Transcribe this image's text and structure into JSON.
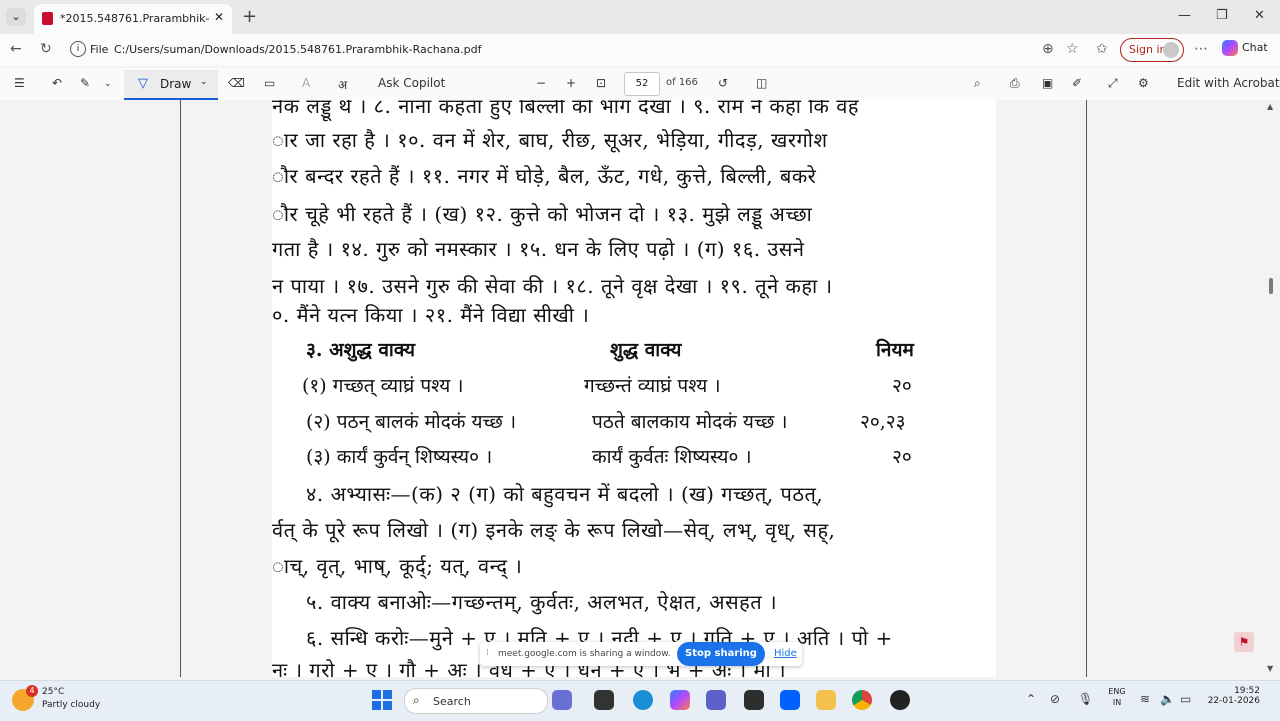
{
  "browser": {
    "tab_title": "*2015.548761.Prarambhik-Rachana.pdf",
    "tab_close": "✕",
    "new_tab": "+",
    "file_label": "File",
    "url": "C:/Users/suman/Downloads/2015.548761.Prarambhik-Rachana.pdf",
    "signin_label": "Sign in",
    "chat_label": "Chat"
  },
  "pdf_toolbar": {
    "draw_label": "Draw",
    "ask_copilot_label": "Ask Copilot",
    "page_current": "52",
    "page_total": "of 166",
    "edit_label": "Edit with Acrobat"
  },
  "page_lines": [
    "नेक लड्डू थे । ८. नाना कहता हुए बिल्ली को भाग देखा । ९. राम ने कहा कि वह",
    "ार जा रहा है । १०. वन में शेर, बाघ, रीछ, सूअर, भेड़िया, गीदड़, खरगोश",
    "ौर बन्दर रहते हैं । ११. नगर में घोड़े, बैल, ऊँट, गधे, कुत्ते, बिल्ली,  बकरे",
    "ौर चूहे भी रहते हैं । (ख) १२. कुत्ते को भोजन दो । १३. मुझे लड्डू अच्छा",
    "गता है । १४. गुरु को नमस्कार । १५. धन के लिए पढ़ो । (ग) १६. उसने",
    "न पाया । १७. उसने गुरु की सेवा की । १८. तूने वृक्ष देखा । १९. तूने कहा ।",
    "०. मैंने यत्न किया । २१. मैंने विद्या सीखी ।",
    "५. वाक्य बनाओः—गच्छन्तम्, कुर्वतः, अलभत, ऐक्षत, असहत ।",
    "६. सन्धि करोः—मुने + ए । मति + ए । नदी + ए । गति + ए । अति । पो +",
    "नः । गुरो + ए । गौ + अः । वधू + ए । धेनु + ए । भू + अः । मौ ।"
  ],
  "table": {
    "heading_left": "३. अशुद्ध वाक्य",
    "heading_mid": "शुद्ध वाक्य",
    "heading_right": "नियम",
    "rows": [
      {
        "wrong": "(१) गच्छत् व्याघ्रं पश्य ।",
        "right": "गच्छन्तं व्याघ्रं पश्य ।",
        "rule": "२०"
      },
      {
        "wrong": "(२) पठन् बालकं मोदकं यच्छ ।",
        "right": "पठते बालकाय मोदकं यच्छ ।",
        "rule": "२०,२३"
      },
      {
        "wrong": "(३) कार्यं कुर्वन् शिष्यस्य० ।",
        "right": "कार्यं कुर्वतः शिष्यस्य० ।",
        "rule": "२०"
      }
    ]
  },
  "exercise4": [
    "४. अभ्यासः—(क) २ (ग) को बहुवचन में बदलो । (ख) गच्छत्, पठत्,",
    "र्वत् के पूरे रूप लिखो । (ग) इनके लङ् के रूप लिखो—सेव्, लभ्, वृध्, सह्,",
    "ाच्, वृत्, भाष्, कूर्द्; यत्, वन्द् ।"
  ],
  "share_bar": {
    "message": "meet.google.com is sharing a window.",
    "stop_label": "Stop sharing",
    "hide_label": "Hide"
  },
  "taskbar": {
    "temp": "25°C",
    "weather": "Partly cloudy",
    "weather_badge": "4",
    "search_label": "Search",
    "lang1": "ENG",
    "lang2": "IN",
    "time": "19:52",
    "date": "22-01-2026"
  }
}
